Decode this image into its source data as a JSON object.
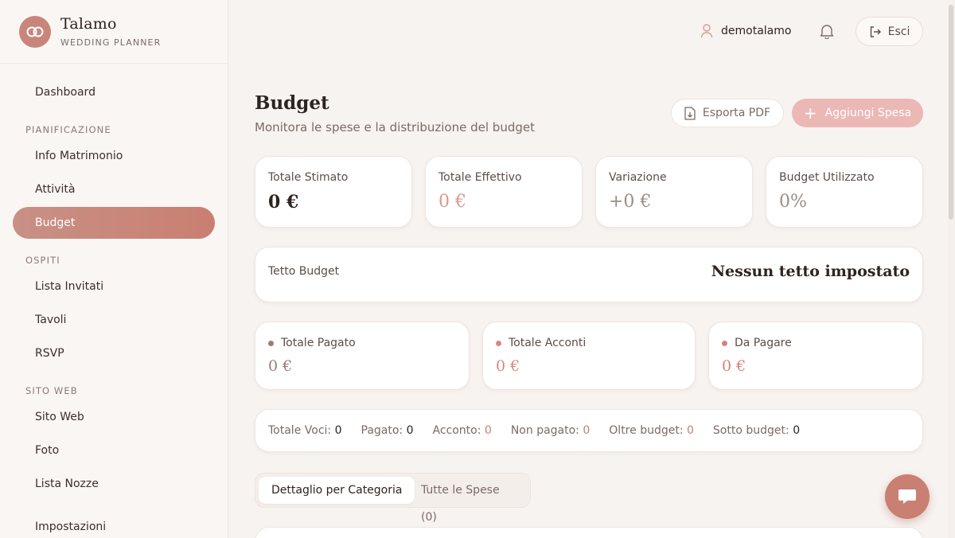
{
  "brand": {
    "name": "Talamo",
    "subtitle": "WEDDING PLANNER",
    "logo_icon": "rings-icon",
    "accent": "#c8857a"
  },
  "sidebar": {
    "dashboard": "Dashboard",
    "sections": [
      {
        "title": "PIANIFICAZIONE",
        "items": [
          "Info Matrimonio",
          "Attività",
          "Budget"
        ]
      },
      {
        "title": "OSPITI",
        "items": [
          "Lista Invitati",
          "Tavoli",
          "RSVP"
        ]
      },
      {
        "title": "SITO WEB",
        "items": [
          "Sito Web",
          "Foto",
          "Lista Nozze"
        ]
      }
    ],
    "settings": "Impostazioni",
    "active": "Budget"
  },
  "topbar": {
    "username": "demotalamo",
    "logout_label": "Esci"
  },
  "page": {
    "title": "Budget",
    "subtitle": "Monitora le spese e la distribuzione del budget",
    "export_label": "Esporta PDF",
    "add_label": "Aggiungi Spesa"
  },
  "stats": [
    {
      "label": "Totale Stimato",
      "value": "0 €"
    },
    {
      "label": "Totale Effettivo",
      "value": "0 €"
    },
    {
      "label": "Variazione",
      "value": "+0 €"
    },
    {
      "label": "Budget Utilizzato",
      "value": "0%"
    }
  ],
  "cap": {
    "label": "Tetto Budget",
    "value": "Nessun tetto impostato"
  },
  "payments": [
    {
      "label": "Totale Pagato",
      "value": "0 €",
      "color": "#9a7d78"
    },
    {
      "label": "Totale Acconti",
      "value": "0 €",
      "color": "#d58a80"
    },
    {
      "label": "Da Pagare",
      "value": "0 €",
      "color": "#d0857a"
    }
  ],
  "summary": [
    {
      "label": "Totale Voci:",
      "value": "0"
    },
    {
      "label": "Pagato:",
      "value": "0"
    },
    {
      "label": "Acconto:",
      "value": "0"
    },
    {
      "label": "Non pagato:",
      "value": "0"
    },
    {
      "label": "Oltre budget:",
      "value": "0"
    },
    {
      "label": "Sotto budget:",
      "value": "0"
    }
  ],
  "tabs": [
    {
      "label": "Dettaglio per Categoria",
      "active": true
    },
    {
      "label": "Tutte le Spese (0)",
      "active": false
    }
  ]
}
